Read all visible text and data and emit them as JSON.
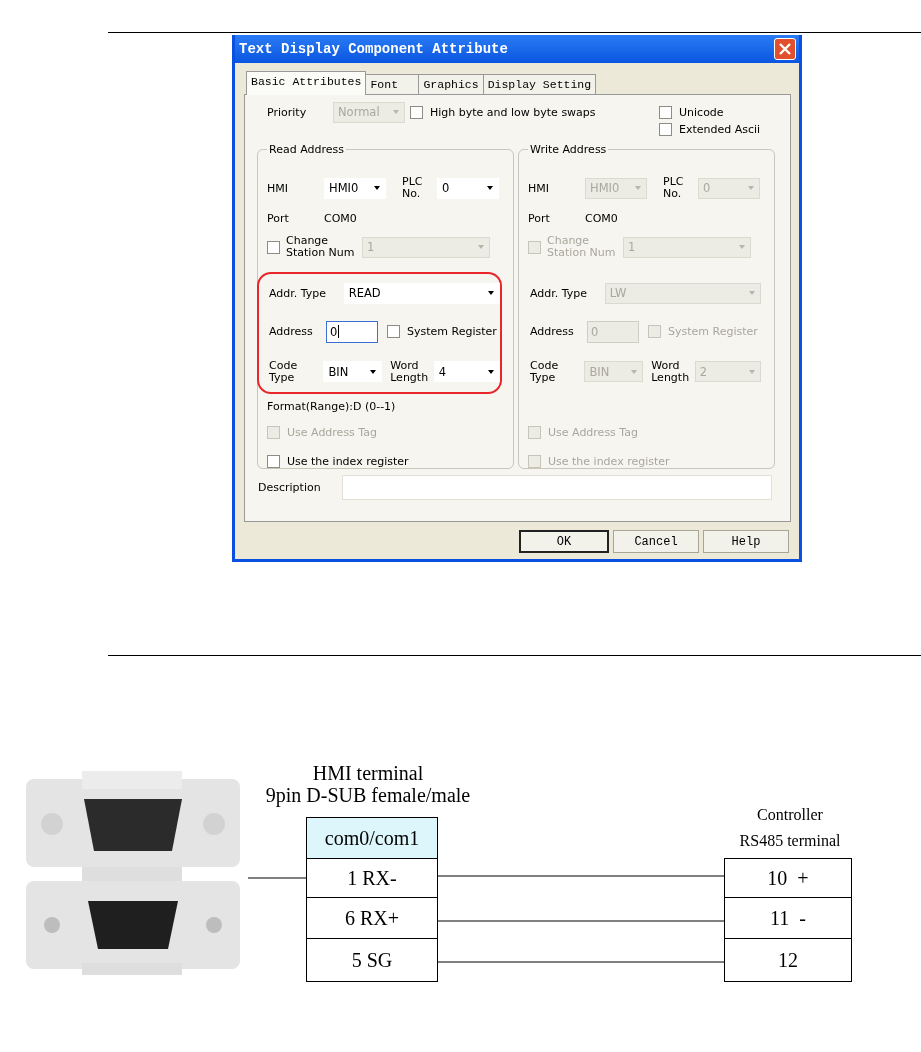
{
  "dialog": {
    "title": "Text Display Component Attribute",
    "tabs": [
      {
        "label": "Basic Attributes",
        "selected": true
      },
      {
        "label": "Font",
        "selected": false
      },
      {
        "label": "Graphics",
        "selected": false
      },
      {
        "label": "Display Setting",
        "selected": false
      }
    ],
    "priority": {
      "label": "Priority",
      "value": "Normal",
      "disabled": true
    },
    "options": [
      {
        "label": "High byte and low byte swaps",
        "checked": false
      },
      {
        "label": "Unicode",
        "checked": false
      },
      {
        "label": "Extended Ascii",
        "checked": false
      }
    ],
    "groups": [
      {
        "title": "Read Address",
        "disabled": false,
        "highlighted": true,
        "hmi_label": "HMI",
        "hmi": "HMI0",
        "plc_label": "PLC No.",
        "plc": "0",
        "port_label": "Port",
        "port": "COM0",
        "station": {
          "label": "Change Station Num",
          "checked": false,
          "value": "1",
          "disabled": true
        },
        "addr_type_label": "Addr. Type",
        "addr_type": "READ",
        "address_label": "Address",
        "address": "0",
        "address_focused": true,
        "system_register": {
          "label": "System Register",
          "checked": false
        },
        "code_type_label": "Code Type",
        "code_type": "BIN",
        "word_length_label": "Word Length",
        "word_length": "4",
        "format": "Format(Range):D (0--1)",
        "address_tag": {
          "label": "Use Address Tag",
          "checked": false,
          "disabled": true
        },
        "index_register": {
          "label": "Use the index register",
          "checked": false,
          "disabled": false
        }
      },
      {
        "title": "Write Address",
        "disabled": true,
        "highlighted": false,
        "hmi_label": "HMI",
        "hmi": "HMI0",
        "plc_label": "PLC No.",
        "plc": "0",
        "port_label": "Port",
        "port": "COM0",
        "station": {
          "label": "Change Station Num",
          "checked": false,
          "value": "1"
        },
        "addr_type_label": "Addr. Type",
        "addr_type": "LW",
        "address_label": "Address",
        "address": "0",
        "address_focused": false,
        "system_register": {
          "label": "System Register",
          "checked": false
        },
        "code_type_label": "Code Type",
        "code_type": "BIN",
        "word_length_label": "Word Length",
        "word_length": "2",
        "address_tag": {
          "label": "Use Address Tag",
          "checked": false
        },
        "index_register": {
          "label": "Use the index register",
          "checked": false
        }
      }
    ],
    "description_label": "Description",
    "buttons": [
      {
        "label": "OK",
        "default": true
      },
      {
        "label": "Cancel",
        "default": false
      },
      {
        "label": "Help",
        "default": false
      }
    ]
  },
  "wiring": {
    "hmi_title": "HMI terminal",
    "hmi_subtitle": "9pin D-SUB female/male",
    "hmi_header": "com0/com1",
    "hmi_pins": [
      "1 RX-",
      "6 RX+",
      "5 SG"
    ],
    "controller_title": "Controller",
    "controller_subtitle": "RS485 terminal",
    "controller_pins": [
      "10  +",
      "11  -",
      "12"
    ]
  }
}
